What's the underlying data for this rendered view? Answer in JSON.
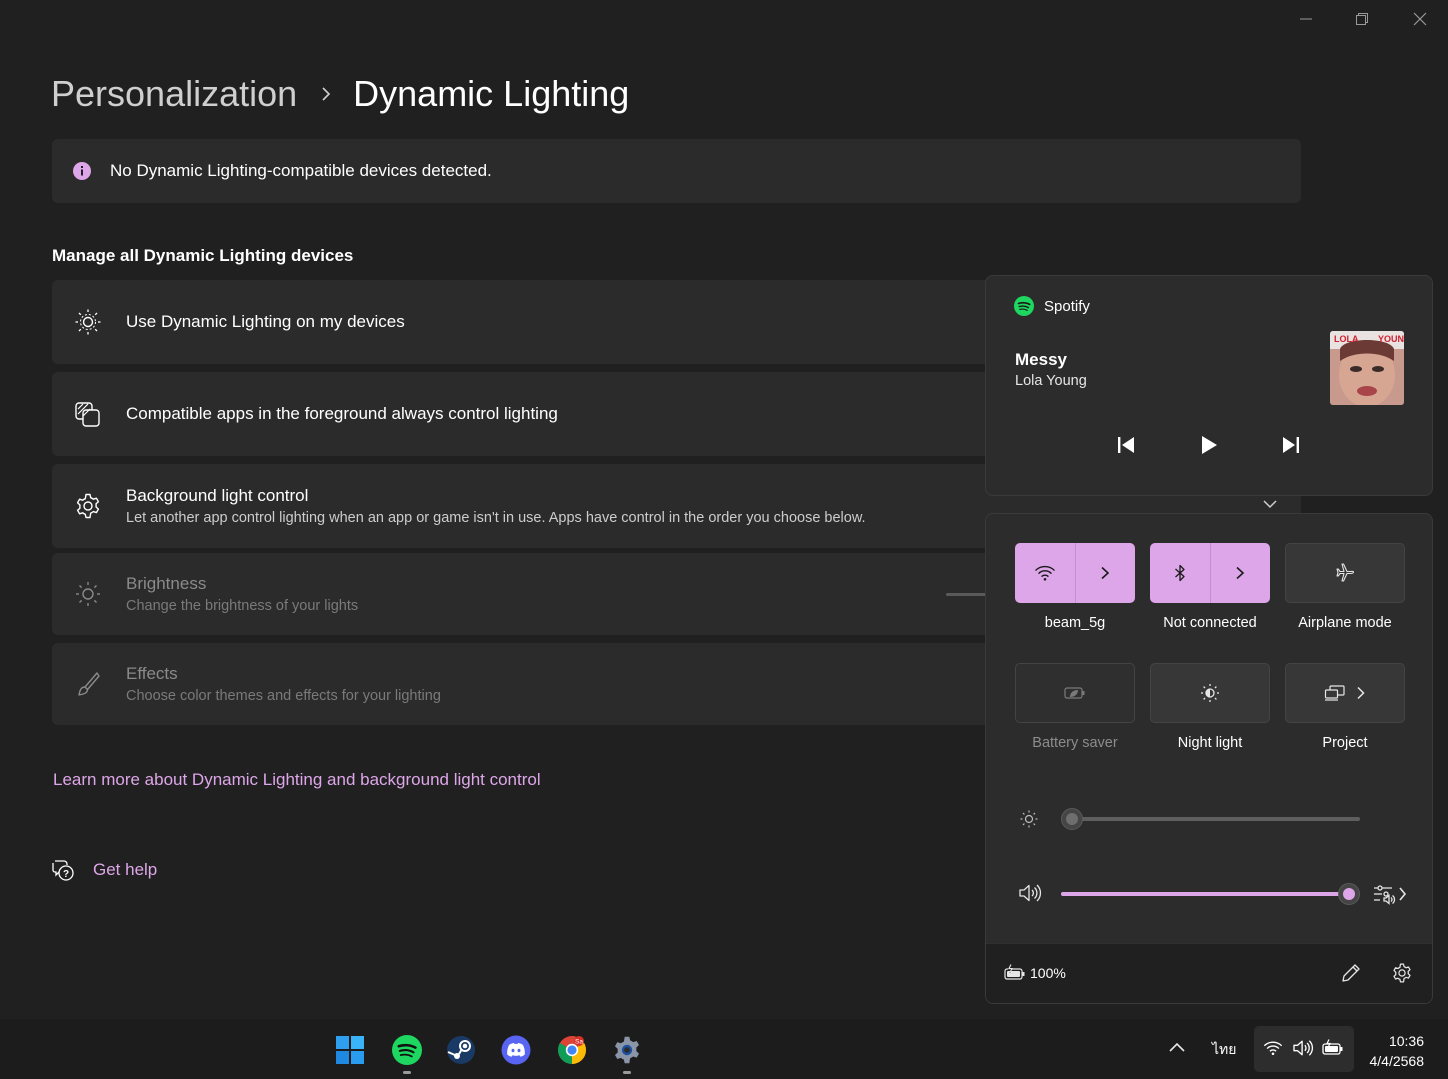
{
  "window": {
    "buttons": [
      "minimize",
      "restore",
      "close"
    ]
  },
  "breadcrumb": {
    "parent": "Personalization",
    "current": "Dynamic Lighting"
  },
  "infobar": {
    "message": "No Dynamic Lighting-compatible devices detected."
  },
  "section": {
    "title": "Manage all Dynamic Lighting devices"
  },
  "cards": [
    {
      "title": "Use Dynamic Lighting on my devices",
      "icon": "dynamic-lighting-icon"
    },
    {
      "title": "Compatible apps in the foreground always control lighting",
      "icon": "apps-icon"
    },
    {
      "title": "Background light control",
      "desc": "Let another app control lighting when an app or game isn't in use. Apps have control in the order you choose below.",
      "icon": "gear-icon"
    },
    {
      "title": "Brightness",
      "desc": "Change the brightness of your lights",
      "icon": "sun-icon",
      "disabled": true
    },
    {
      "title": "Effects",
      "desc": "Choose color themes and effects for your lighting",
      "icon": "brush-icon",
      "disabled": true
    }
  ],
  "links": {
    "learn_more": "Learn more about Dynamic Lighting and background light control",
    "get_help": "Get help"
  },
  "media": {
    "app": "Spotify",
    "song": "Messy",
    "artist": "Lola Young"
  },
  "quick_settings": {
    "tiles": [
      {
        "label": "beam_5g",
        "icon": "wifi-icon",
        "on": true
      },
      {
        "label": "Not connected",
        "icon": "bluetooth-icon",
        "on": true
      },
      {
        "label": "Airplane mode",
        "icon": "airplane-icon",
        "on": false
      },
      {
        "label": "Battery saver",
        "icon": "battery-saver-icon",
        "on": false,
        "disabled": true
      },
      {
        "label": "Night light",
        "icon": "night-light-icon",
        "on": false
      },
      {
        "label": "Project",
        "icon": "project-icon",
        "on": false
      }
    ],
    "brightness_level": 0,
    "volume_level": 1.0,
    "battery": "100%",
    "accent": "#dda6e8"
  },
  "taskbar": {
    "apps": [
      "start-icon",
      "spotify-icon",
      "steam-icon",
      "discord-icon",
      "chrome-icon",
      "settings-icon"
    ],
    "language": "ไทย",
    "time": "10:36",
    "date": "4/4/2568"
  }
}
